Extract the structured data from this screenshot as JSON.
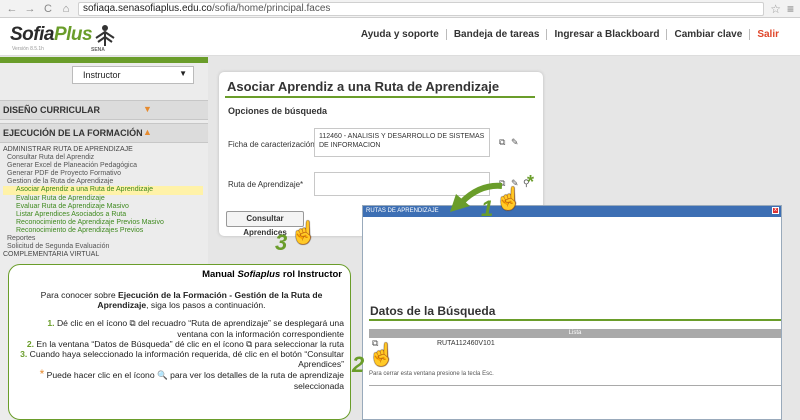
{
  "browser": {
    "url_host": "sofiaqa.senasofiaplus.edu.co",
    "url_path": "/sofia/home/principal.faces"
  },
  "header": {
    "logo_main": "Sofia",
    "logo_plus": "Plus",
    "logo_version": "Versión 8.5.1h",
    "sena_label": "SENA",
    "menu": [
      {
        "label": "Ayuda y soporte"
      },
      {
        "label": "Bandeja de tareas"
      },
      {
        "label": "Ingresar a Blackboard"
      },
      {
        "label": "Cambiar clave"
      },
      {
        "label": "Salir"
      }
    ]
  },
  "sidebar": {
    "role": "Instructor",
    "section_diseno": "DISEÑO CURRICULAR",
    "section_ejecucion": "EJECUCIÓN DE LA FORMACIÓN",
    "items": [
      {
        "label": "ADMINISTRAR RUTA DE APRENDIZAJE",
        "level": "top"
      },
      {
        "label": "Consultar Ruta del Aprendiz",
        "level": "l1"
      },
      {
        "label": "Generar Excel de Planeación Pedagógica",
        "level": "l1"
      },
      {
        "label": "Generar PDF de Proyecto Formativo",
        "level": "l1"
      },
      {
        "label": "Gestion de la Ruta de Aprendizaje",
        "level": "l1"
      },
      {
        "label": "Asociar Aprendiz a una Ruta de Aprendizaje",
        "level": "l2 active"
      },
      {
        "label": "Evaluar Ruta de Aprendizaje",
        "level": "l2"
      },
      {
        "label": "Evaluar Ruta de Aprendizaje Masivo",
        "level": "l2"
      },
      {
        "label": "Listar Aprendices Asociados a Ruta",
        "level": "l2"
      },
      {
        "label": "Reconocimiento de Aprendizaje Previos Masivo",
        "level": "l2"
      },
      {
        "label": "Reconocimiento de Aprendizajes Previos",
        "level": "l2"
      },
      {
        "label": "Reportes",
        "level": "l1"
      },
      {
        "label": "Solicitud de Segunda Evaluación",
        "level": "l1"
      },
      {
        "label": "COMPLEMENTARIA VIRTUAL",
        "level": "top"
      }
    ]
  },
  "form": {
    "title": "Asociar Aprendiz a una Ruta de Aprendizaje",
    "subtitle": "Opciones de búsqueda",
    "ficha_label": "Ficha de caracterización*",
    "ficha_value": "112460 - ANALISIS Y DESARROLLO DE SISTEMAS DE INFORMACION",
    "ruta_label": "Ruta de Aprendizaje*",
    "ruta_value": "",
    "consultar_label": "Consultar Aprendices"
  },
  "popup": {
    "title": "RUTAS DE APRENDIZAJE",
    "close": "x",
    "results_title": "Datos de la Búsqueda",
    "table_header": "Lista",
    "rows": [
      {
        "value": "RUTA112460V101"
      }
    ],
    "esc_note": "Para cerrar esta ventana presione la tecla Esc."
  },
  "callout": {
    "title_prefix": "Manual ",
    "title_em": "Sofiaplus",
    "title_suffix": " rol Instructor",
    "intro_1": "Para conocer sobre ",
    "intro_bold": "Ejecución de la Formación - Gestión de la Ruta de Aprendizaje",
    "intro_2": ", siga los pasos a continuación.",
    "step1_num": "1.",
    "step1": " Dé clic en el ícono ⧉ del recuadro “Ruta de aprendizaje” se desplegará una ventana con la información correspondiente",
    "step2_num": "2.",
    "step2": " En la ventana “Datos de Búsqueda” dé clic en el ícono ⧉ para seleccionar la ruta",
    "step3_num": "3.",
    "step3": " Cuando haya seleccionado la información requerida, dé clic en el botón “Consultar Aprendices”",
    "note_star": "*",
    "note": " Puede hacer clic en el ícono 🔍 para ver los detalles de la ruta de aprendizaje seleccionada"
  },
  "annotations": {
    "step1": "1",
    "step2": "2",
    "step3": "3",
    "star": "*"
  }
}
